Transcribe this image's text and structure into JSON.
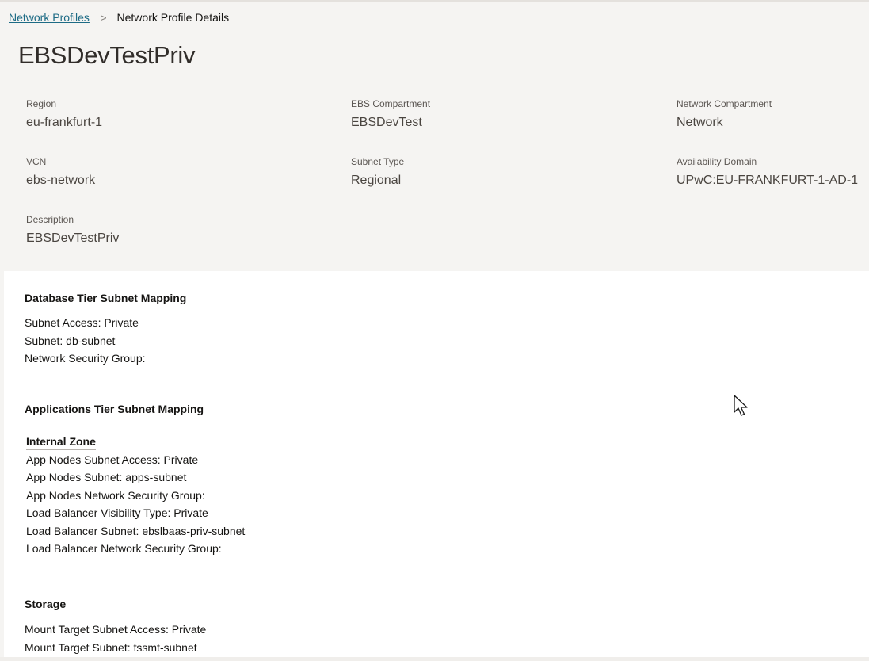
{
  "breadcrumb": {
    "parent": "Network Profiles",
    "separator": ">",
    "current": "Network Profile Details"
  },
  "page_title": "EBSDevTestPriv",
  "details": {
    "region": {
      "label": "Region",
      "value": "eu-frankfurt-1"
    },
    "ebs_compartment": {
      "label": "EBS Compartment",
      "value": "EBSDevTest"
    },
    "network_compartment": {
      "label": "Network Compartment",
      "value": "Network"
    },
    "vcn": {
      "label": "VCN",
      "value": "ebs-network"
    },
    "subnet_type": {
      "label": "Subnet Type",
      "value": "Regional"
    },
    "availability_domain": {
      "label": "Availability Domain",
      "value": "UPwC:EU-FRANKFURT-1-AD-1"
    },
    "description": {
      "label": "Description",
      "value": "EBSDevTestPriv"
    }
  },
  "db_tier": {
    "title": "Database Tier Subnet Mapping",
    "lines": [
      "Subnet Access: Private",
      "Subnet: db-subnet",
      "Network Security Group:"
    ]
  },
  "apps_tier": {
    "title": "Applications Tier Subnet Mapping",
    "zone_title": "Internal Zone",
    "lines": [
      "App Nodes Subnet Access: Private",
      "App Nodes Subnet: apps-subnet",
      "App Nodes Network Security Group:",
      "Load Balancer Visibility Type: Private",
      "Load Balancer Subnet: ebslbaas-priv-subnet",
      "Load Balancer Network Security Group:"
    ]
  },
  "storage": {
    "title": "Storage",
    "lines": [
      "Mount Target Subnet Access: Private",
      "Mount Target Subnet: fssmt-subnet"
    ]
  },
  "icons": {
    "cursor": "mouse-pointer-icon"
  },
  "colors": {
    "link": "#1d6b85",
    "header_background": "#f5f4f2",
    "content_background": "#ffffff"
  }
}
